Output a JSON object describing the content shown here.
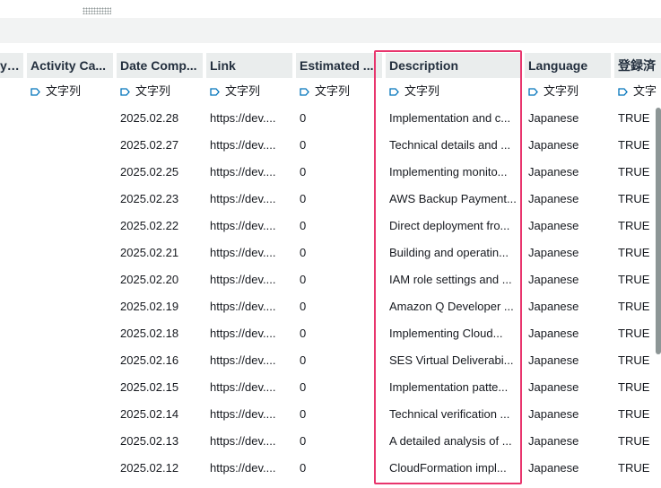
{
  "columns": [
    {
      "label": "ype"
    },
    {
      "label": "Activity Ca..."
    },
    {
      "label": "Date Comp..."
    },
    {
      "label": "Link"
    },
    {
      "label": "Estimated ..."
    },
    {
      "label": "Description"
    },
    {
      "label": "Language"
    },
    {
      "label": "登録済"
    }
  ],
  "type_row": [
    "",
    "文字列",
    "文字列",
    "文字列",
    "文字列",
    "文字列",
    "文字列",
    "文字"
  ],
  "rows": [
    [
      "2025.02.28",
      "https://dev....",
      "0",
      "Implementation and c...",
      "Japanese",
      "TRUE"
    ],
    [
      "2025.02.27",
      "https://dev....",
      "0",
      "Technical details and ...",
      "Japanese",
      "TRUE"
    ],
    [
      "2025.02.25",
      "https://dev....",
      "0",
      "Implementing monito...",
      "Japanese",
      "TRUE"
    ],
    [
      "2025.02.23",
      "https://dev....",
      "0",
      "AWS Backup Payment...",
      "Japanese",
      "TRUE"
    ],
    [
      "2025.02.22",
      "https://dev....",
      "0",
      "Direct deployment fro...",
      "Japanese",
      "TRUE"
    ],
    [
      "2025.02.21",
      "https://dev....",
      "0",
      "Building and operatin...",
      "Japanese",
      "TRUE"
    ],
    [
      "2025.02.20",
      "https://dev....",
      "0",
      "IAM role settings and ...",
      "Japanese",
      "TRUE"
    ],
    [
      "2025.02.19",
      "https://dev....",
      "0",
      "Amazon Q Developer ...",
      "Japanese",
      "TRUE"
    ],
    [
      "2025.02.18",
      "https://dev....",
      "0",
      "Implementing Cloud...",
      "Japanese",
      "TRUE"
    ],
    [
      "2025.02.16",
      "https://dev....",
      "0",
      "SES Virtual Deliverabi...",
      "Japanese",
      "TRUE"
    ],
    [
      "2025.02.15",
      "https://dev....",
      "0",
      "Implementation patte...",
      "Japanese",
      "TRUE"
    ],
    [
      "2025.02.14",
      "https://dev....",
      "0",
      "Technical verification ...",
      "Japanese",
      "TRUE"
    ],
    [
      "2025.02.13",
      "https://dev....",
      "0",
      "A detailed analysis of ...",
      "Japanese",
      "TRUE"
    ],
    [
      "2025.02.12",
      "https://dev....",
      "0",
      "CloudFormation impl...",
      "Japanese",
      "TRUE"
    ]
  ],
  "colors": {
    "highlight": "#e8356d",
    "tag_icon": "#0073bb",
    "header_bg": "#eaeded"
  },
  "icons": {
    "type_tag": "tag-icon"
  }
}
